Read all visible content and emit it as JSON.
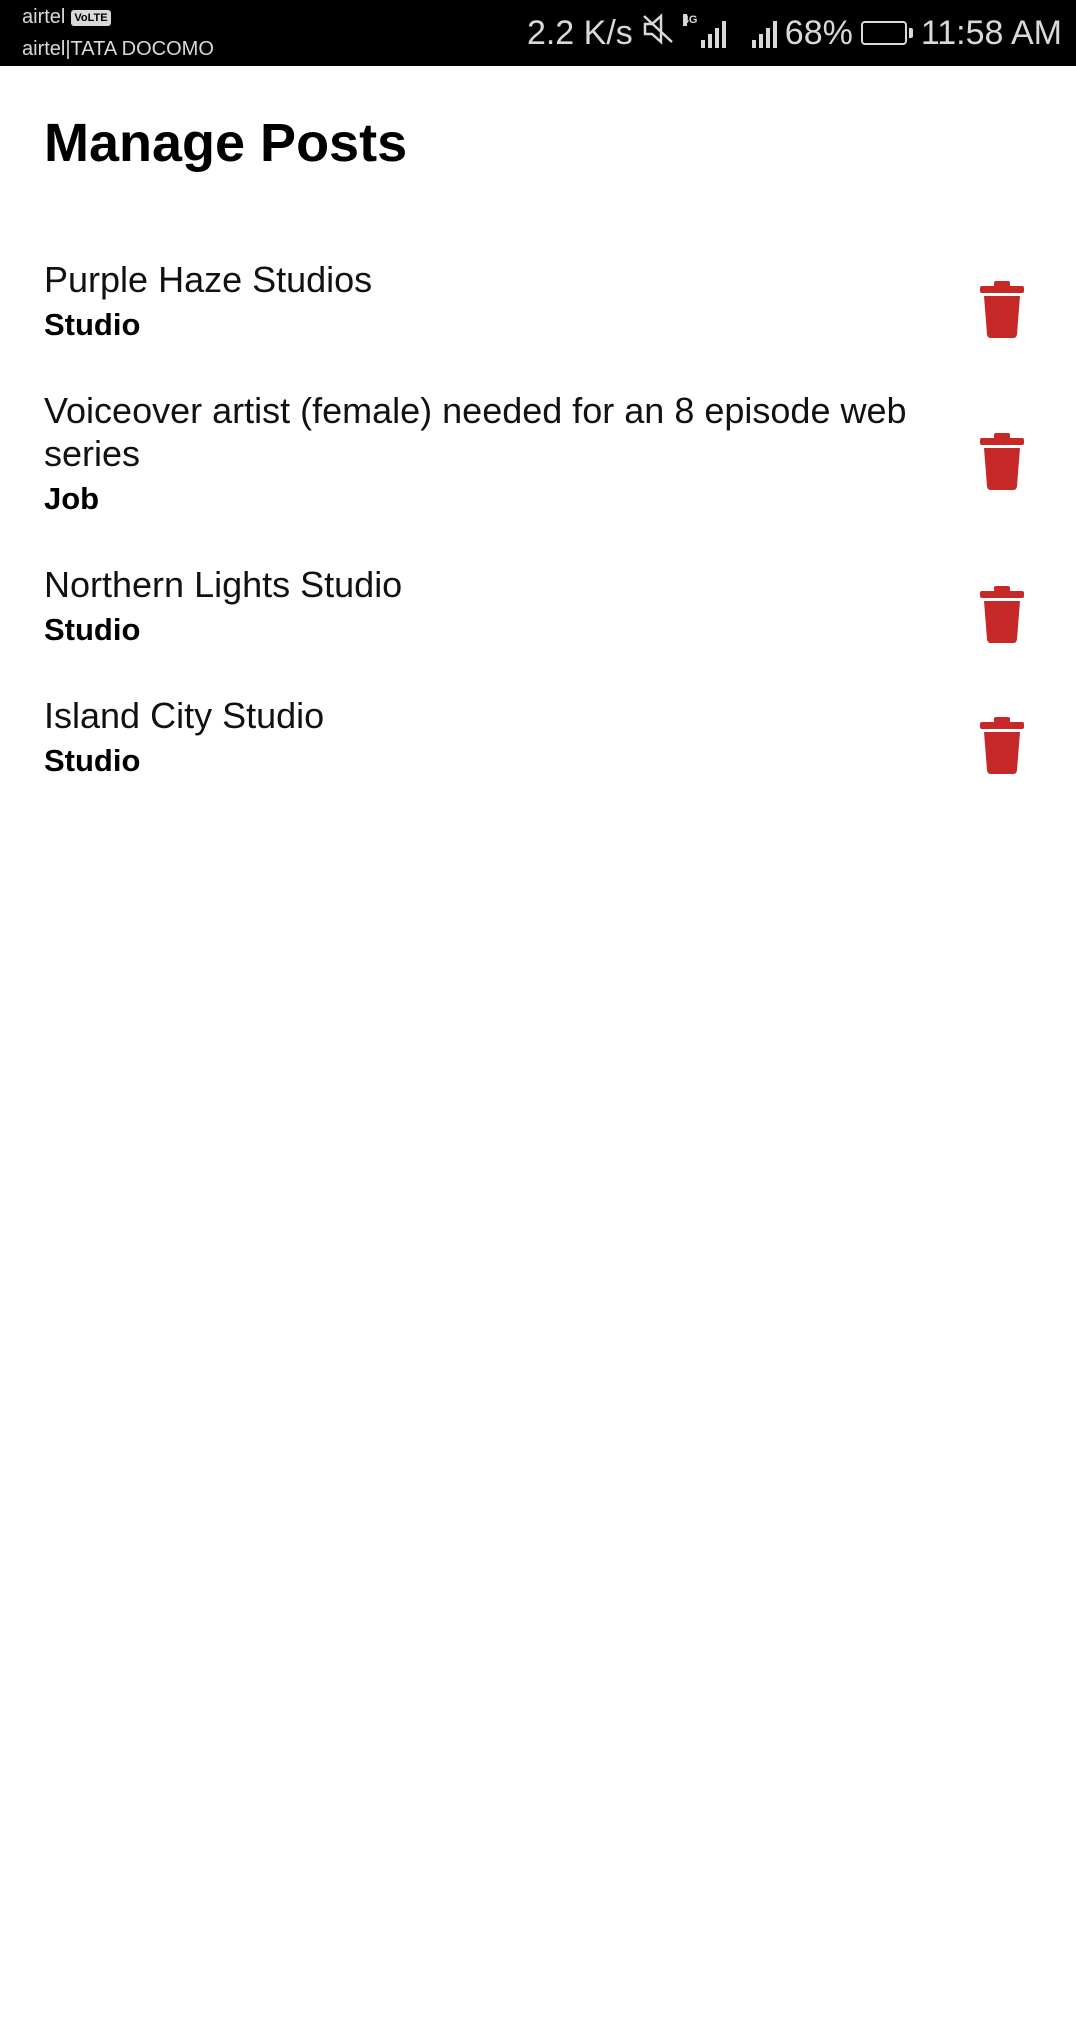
{
  "status_bar": {
    "carrier_primary": "airtel",
    "volte_badge": "VoLTE",
    "carrier_secondary": "airtel|TATA DOCOMO",
    "network_speed": "2.2 K/s",
    "network_type": "4G",
    "battery_percent": "68%",
    "battery_level": 0.68,
    "time": "11:58 AM",
    "icons": [
      "mute-icon",
      "signal-4g-icon",
      "signal-icon",
      "battery-icon"
    ]
  },
  "page": {
    "title": "Manage Posts"
  },
  "posts": [
    {
      "title": "Purple Haze Studios",
      "type": "Studio"
    },
    {
      "title": "Voiceover artist (female) needed for an 8 episode web series",
      "type": "Job"
    },
    {
      "title": "Northern Lights Studio",
      "type": "Studio"
    },
    {
      "title": "Island City Studio",
      "type": "Studio"
    }
  ],
  "colors": {
    "delete_icon": "#c62828",
    "status_bar_bg": "#000000",
    "background": "#ffffff"
  },
  "icons": {
    "delete": "trash-icon"
  }
}
